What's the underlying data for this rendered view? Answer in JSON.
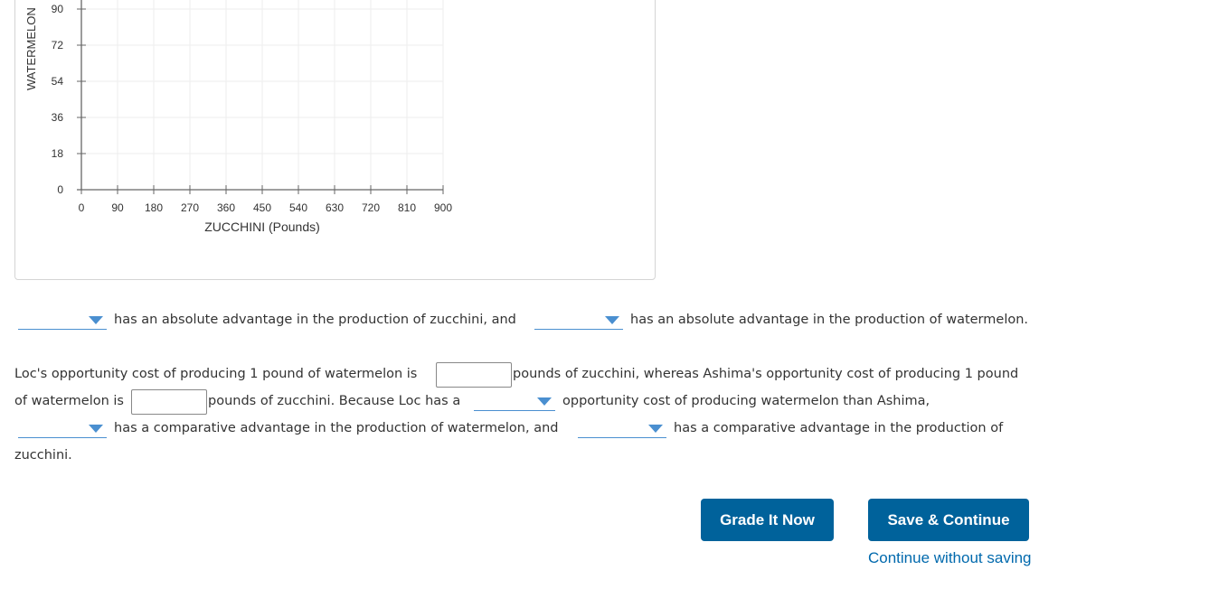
{
  "chart_data": {
    "type": "line",
    "xlabel": "ZUCCHINI (Pounds)",
    "ylabel": "WATERMELON",
    "xlim": [
      0,
      900
    ],
    "ylim": [
      0,
      90
    ],
    "x_ticks": [
      "0",
      "90",
      "180",
      "270",
      "360",
      "450",
      "540",
      "630",
      "720",
      "810",
      "900"
    ],
    "y_ticks": [
      "0",
      "18",
      "36",
      "54",
      "72",
      "90"
    ],
    "grid": true,
    "series": []
  },
  "question": {
    "line1_text_a": "has an absolute advantage in the production of zucchini, and",
    "line1_text_b": "has an absolute advantage in the production of watermelon.",
    "p_a": "Loc's opportunity cost of producing 1 pound of watermelon is",
    "p_b": "pounds of zucchini, whereas Ashima's opportunity cost of producing 1 pound",
    "p_c": "of watermelon is",
    "p_d": "pounds of zucchini. Because Loc has a",
    "p_e": "opportunity cost of producing watermelon than Ashima,",
    "p_f": "has a comparative advantage in the production of watermelon, and",
    "p_g": "has a comparative advantage in the production of",
    "p_h": "zucchini.",
    "loc_cost_value": "",
    "ashima_cost_value": ""
  },
  "buttons": {
    "grade": "Grade It Now",
    "save": "Save & Continue",
    "continue_link": "Continue without saving"
  },
  "colors": {
    "button": "#00629b",
    "dropdown": "#4a8fd0",
    "link": "#0069ad"
  }
}
